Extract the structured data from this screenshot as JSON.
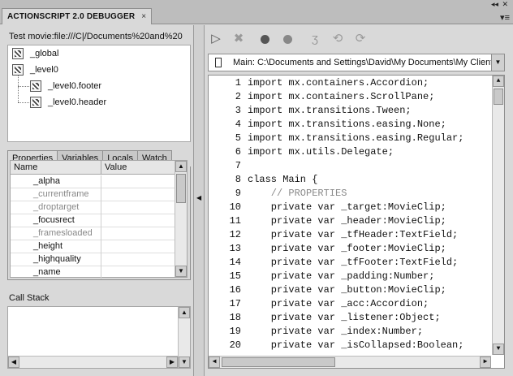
{
  "window": {
    "title": "ACTIONSCRIPT 2.0 DEBUGGER",
    "close_glyph": "×",
    "collapse_glyph": "◂◂",
    "panel_close_glyph": "✕",
    "menu_glyph": "▾≡"
  },
  "left": {
    "movie_label": "Test movie:file:///C|/Documents%20and%20",
    "tree": [
      "_global",
      "_level0",
      "_level0.footer",
      "_level0.header"
    ],
    "tabs": [
      "Properties",
      "Variables",
      "Locals",
      "Watch"
    ],
    "grid": {
      "headers": [
        "Name",
        "Value"
      ],
      "rows": [
        {
          "name": "_alpha",
          "dim": false
        },
        {
          "name": "_currentframe",
          "dim": true
        },
        {
          "name": "_droptarget",
          "dim": true
        },
        {
          "name": "_focusrect",
          "dim": false
        },
        {
          "name": "_framesloaded",
          "dim": true
        },
        {
          "name": "_height",
          "dim": false
        },
        {
          "name": "_highquality",
          "dim": false
        },
        {
          "name": "_name",
          "dim": false
        }
      ]
    },
    "callstack_label": "Call Stack"
  },
  "toolbar": {
    "icons": [
      "continue-icon",
      "stop-debugging-icon",
      "toggle-breakpoint-icon",
      "remove-breakpoints-icon",
      "step-over-icon",
      "step-in-icon",
      "step-out-icon"
    ],
    "glyphs": [
      "▷",
      "✖",
      "",
      "",
      "ʒ",
      "⟲",
      "⟳"
    ]
  },
  "script": {
    "path": "Main: C:\\Documents and Settings\\David\\My Documents\\My Clients",
    "dropdown_glyph": "▼"
  },
  "code": [
    {
      "n": "1",
      "t": "import mx.containers.Accordion;"
    },
    {
      "n": "2",
      "t": "import mx.containers.ScrollPane;"
    },
    {
      "n": "3",
      "t": "import mx.transitions.Tween;"
    },
    {
      "n": "4",
      "t": "import mx.transitions.easing.None;"
    },
    {
      "n": "5",
      "t": "import mx.transitions.easing.Regular;"
    },
    {
      "n": "6",
      "t": "import mx.utils.Delegate;"
    },
    {
      "n": "7",
      "t": ""
    },
    {
      "n": "8",
      "t": "class Main {"
    },
    {
      "n": "9",
      "t": "    // PROPERTIES",
      "comment": true
    },
    {
      "n": "10",
      "t": "    private var _target:MovieClip;"
    },
    {
      "n": "11",
      "t": "    private var _header:MovieClip;"
    },
    {
      "n": "12",
      "t": "    private var _tfHeader:TextField;"
    },
    {
      "n": "13",
      "t": "    private var _footer:MovieClip;"
    },
    {
      "n": "14",
      "t": "    private var _tfFooter:TextField;"
    },
    {
      "n": "15",
      "t": "    private var _padding:Number;"
    },
    {
      "n": "16",
      "t": "    private var _button:MovieClip;"
    },
    {
      "n": "17",
      "t": "    private var _acc:Accordion;"
    },
    {
      "n": "18",
      "t": "    private var _listener:Object;"
    },
    {
      "n": "19",
      "t": "    private var _index:Number;"
    },
    {
      "n": "20",
      "t": "    private var _isCollapsed:Boolean;"
    }
  ],
  "scroll_glyphs": {
    "up": "▲",
    "down": "▼",
    "left": "◀",
    "right": "▶",
    "grip": "◀"
  }
}
